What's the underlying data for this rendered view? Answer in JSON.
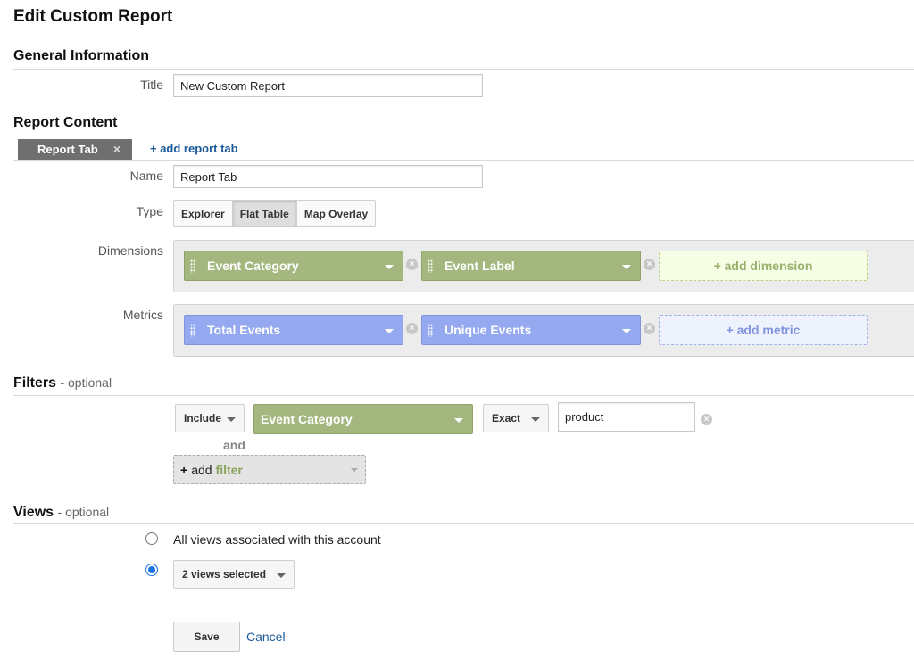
{
  "page_title": "Edit Custom Report",
  "general": {
    "heading": "General Information",
    "title_label": "Title",
    "title_value": "New Custom Report"
  },
  "content": {
    "heading": "Report Content",
    "tab_label": "Report Tab",
    "tab_close": "×",
    "add_tab": "+ add report tab",
    "name_label": "Name",
    "name_value": "Report Tab",
    "type_label": "Type",
    "types": [
      "Explorer",
      "Flat Table",
      "Map Overlay"
    ],
    "selected_type": "Flat Table",
    "dimensions_label": "Dimensions",
    "dimensions": [
      "Event Category",
      "Event Label"
    ],
    "add_dimension": "+ add dimension",
    "metrics_label": "Metrics",
    "metrics": [
      "Total Events",
      "Unique Events"
    ],
    "add_metric": "+ add metric",
    "remove_glyph": "×"
  },
  "filters": {
    "heading": "Filters",
    "optional": "- optional",
    "include": "Include",
    "dimension": "Event Category",
    "match": "Exact",
    "value": "product",
    "and": "and",
    "add_plus": "+",
    "add_word": "add",
    "add_filter": "filter"
  },
  "views": {
    "heading": "Views",
    "optional": "- optional",
    "all_views": "All views associated with this account",
    "selected": "2 views selected",
    "selected_option_index": 1
  },
  "actions": {
    "save": "Save",
    "cancel": "Cancel"
  },
  "colors": {
    "dimension_chip": "#a3b77e",
    "metric_chip": "#94a9f0",
    "link": "#1a5a9a",
    "radio_selected": "#1a73e8"
  },
  "icons": {
    "drag_handle": "drag-handle-icon",
    "dropdown": "chevron-down-icon",
    "remove": "remove-circle-icon",
    "close": "close-icon"
  }
}
